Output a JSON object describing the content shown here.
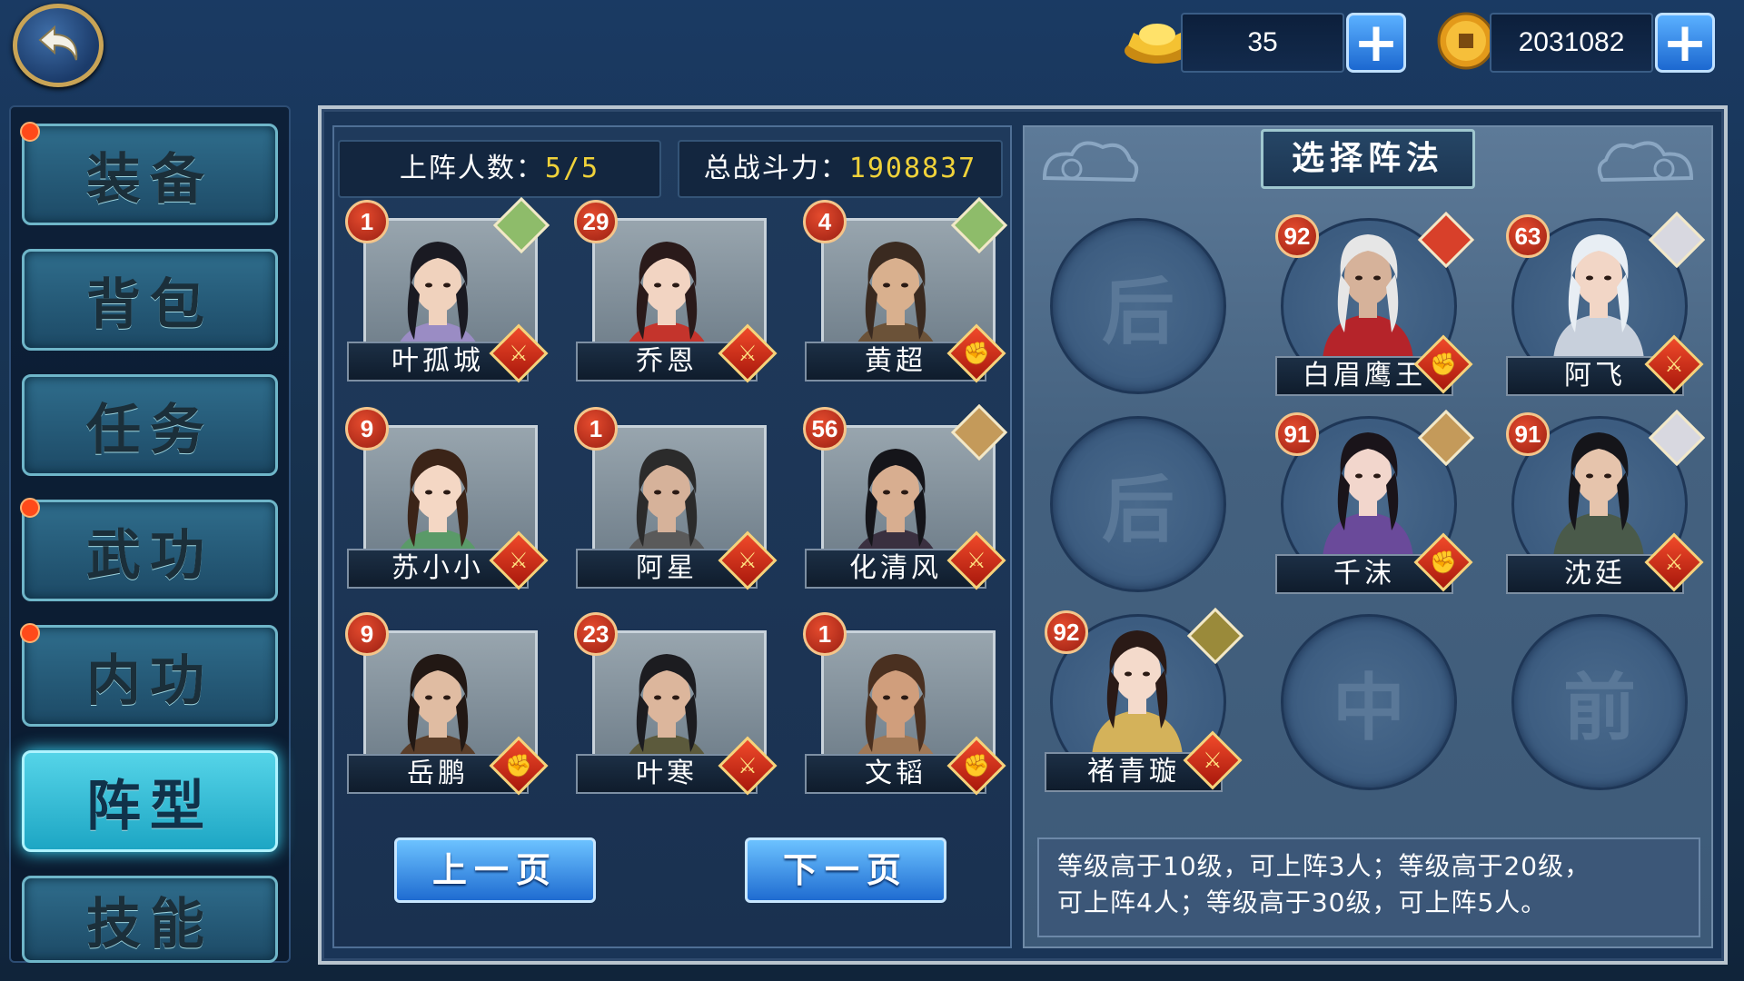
{
  "topbar": {
    "back_icon": "back-arrow-icon",
    "gold": {
      "icon": "gold-ingot-icon",
      "value": "35"
    },
    "coins": {
      "icon": "copper-coin-icon",
      "value": "2031082"
    },
    "plus_label": "+"
  },
  "sidebar": {
    "items": [
      {
        "label": "装备",
        "badge": true
      },
      {
        "label": "背包",
        "badge": false
      },
      {
        "label": "任务",
        "badge": false
      },
      {
        "label": "武功",
        "badge": true
      },
      {
        "label": "内功",
        "badge": true
      },
      {
        "label": "阵型",
        "badge": false,
        "active": true
      },
      {
        "label": "技能",
        "badge": false
      }
    ]
  },
  "roster": {
    "team_count_label": "上阵人数：",
    "team_count_value": "5/5",
    "power_label": "总战斗力：",
    "power_value": "1908837",
    "heroes": [
      {
        "name": "叶孤城",
        "level": "1",
        "class_icon": "sword-icon",
        "element_icon": "frog-icon",
        "hair": "#1a1a22",
        "skin": "#f0d2bd",
        "robe": "#9a8cc4"
      },
      {
        "name": "乔恩",
        "level": "29",
        "class_icon": "sword-icon",
        "element_icon": "",
        "hair": "#2a1a1a",
        "skin": "#f2d4c2",
        "robe": "#c4342c"
      },
      {
        "name": "黄超",
        "level": "4",
        "class_icon": "fist-icon",
        "element_icon": "frog-icon",
        "hair": "#3a2a20",
        "skin": "#d9b08e",
        "robe": "#6b5238"
      },
      {
        "name": "苏小小",
        "level": "9",
        "class_icon": "sword-icon",
        "element_icon": "",
        "hair": "#3b2418",
        "skin": "#f4d7c4",
        "robe": "#5a9a68"
      },
      {
        "name": "阿星",
        "level": "1",
        "class_icon": "sword-icon",
        "element_icon": "",
        "hair": "#2b2b2b",
        "skin": "#d6b29a",
        "robe": "#5a5a5a"
      },
      {
        "name": "化清风",
        "level": "56",
        "class_icon": "sword-icon",
        "element_icon": "tiger-icon",
        "hair": "#15151a",
        "skin": "#d8ae90",
        "robe": "#3a3040"
      },
      {
        "name": "岳鹏",
        "level": "9",
        "class_icon": "fist-icon",
        "element_icon": "",
        "hair": "#221814",
        "skin": "#e0bca2",
        "robe": "#5a3e2a"
      },
      {
        "name": "叶寒",
        "level": "23",
        "class_icon": "sword-icon",
        "element_icon": "",
        "hair": "#1c1c20",
        "skin": "#dcb69c",
        "robe": "#5c5a3c"
      },
      {
        "name": "文韬",
        "level": "1",
        "class_icon": "fist-icon",
        "element_icon": "",
        "hair": "#4a3020",
        "skin": "#d09e7c",
        "robe": "#a07856"
      }
    ],
    "prev_page": "上一页",
    "next_page": "下一页"
  },
  "formation": {
    "title": "选择阵法",
    "empty_slots": [
      {
        "label": "后"
      },
      {
        "label": "后"
      },
      {
        "label": "中"
      },
      {
        "label": "前"
      }
    ],
    "placed": [
      {
        "name": "白眉鹰王",
        "level": "92",
        "class_icon": "fist-icon",
        "element_icon": "fire-icon",
        "hair": "#e6e6e6",
        "skin": "#d6b29a",
        "robe": "#b5242a"
      },
      {
        "name": "阿飞",
        "level": "63",
        "class_icon": "sword-icon",
        "element_icon": "wolf-icon",
        "hair": "#e8eef4",
        "skin": "#f2d6c6",
        "robe": "#c8d0dc"
      },
      {
        "name": "千沫",
        "level": "91",
        "class_icon": "fist-icon",
        "element_icon": "tiger-icon",
        "hair": "#1a141a",
        "skin": "#f2d6cc",
        "robe": "#6a4a9a"
      },
      {
        "name": "沈廷",
        "level": "91",
        "class_icon": "sword-icon",
        "element_icon": "wolf-icon",
        "hair": "#15151a",
        "skin": "#e6c4ac",
        "robe": "#4a5a4a"
      },
      {
        "name": "褚青璇",
        "level": "92",
        "class_icon": "sword-icon",
        "element_icon": "beast-icon",
        "hair": "#2a1a16",
        "skin": "#f4dacb",
        "robe": "#d4b25a"
      }
    ],
    "info_line1": "等级高于10级，可上阵3人；等级高于20级，",
    "info_line2": "可上阵4人；等级高于30级，可上阵5人。"
  },
  "colors": {
    "accent": "#f0d23a",
    "active_tab": "#3ee0ff",
    "button_blue": "#1f6cd1"
  }
}
